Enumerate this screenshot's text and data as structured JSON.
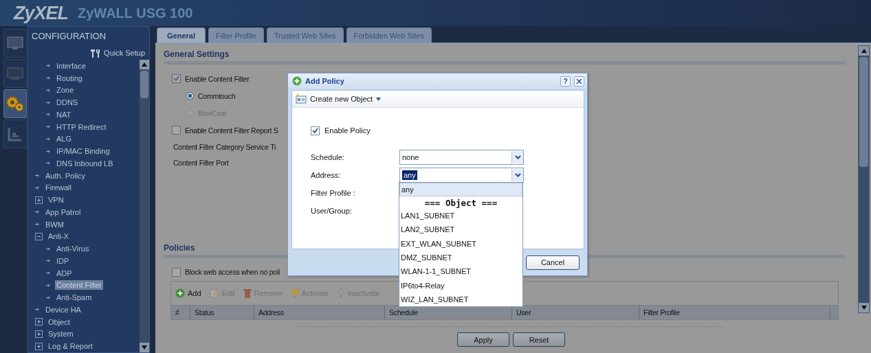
{
  "header": {
    "logo": "ZyXEL",
    "product": "ZyWALL USG 100"
  },
  "side_tabs": [
    {
      "kind": "monitor",
      "selected": false
    },
    {
      "kind": "screen",
      "selected": false
    },
    {
      "kind": "gears",
      "selected": true
    },
    {
      "kind": "chart",
      "selected": false
    }
  ],
  "nav": {
    "title": "CONFIGURATION",
    "quick_setup": "Quick Setup",
    "items": [
      {
        "kind": "continued",
        "children": [
          {
            "label": "Interface",
            "kind": "leaf",
            "selected": false
          },
          {
            "label": "Routing",
            "kind": "leaf",
            "selected": false
          },
          {
            "label": "Zone",
            "kind": "leaf",
            "selected": false
          },
          {
            "label": "DDNS",
            "kind": "leaf",
            "selected": false
          },
          {
            "label": "NAT",
            "kind": "leaf",
            "selected": false
          },
          {
            "label": "HTTP Redirect",
            "kind": "leaf",
            "selected": false
          },
          {
            "label": "ALG",
            "kind": "leaf",
            "selected": false
          },
          {
            "label": "IP/MAC Binding",
            "kind": "leaf",
            "selected": false
          },
          {
            "label": "DNS Inbound LB",
            "kind": "leaf",
            "selected": false
          }
        ]
      },
      {
        "label": "Auth. Policy",
        "kind": "leaf",
        "selected": false
      },
      {
        "label": "Firewall",
        "kind": "leaf",
        "selected": false
      },
      {
        "label": "VPN",
        "kind": "group",
        "expanded": false,
        "selected": false
      },
      {
        "label": "App Patrol",
        "kind": "leaf",
        "selected": false
      },
      {
        "label": "BWM",
        "kind": "leaf",
        "selected": false
      },
      {
        "label": "Anti-X",
        "kind": "group",
        "expanded": true,
        "selected": false,
        "children": [
          {
            "label": "Anti-Virus",
            "kind": "leaf",
            "selected": false
          },
          {
            "label": "IDP",
            "kind": "leaf",
            "selected": false
          },
          {
            "label": "ADP",
            "kind": "leaf",
            "selected": false
          },
          {
            "label": "Content Filter",
            "kind": "leaf",
            "selected": true
          },
          {
            "label": "Anti-Spam",
            "kind": "leaf",
            "selected": false
          }
        ]
      },
      {
        "label": "Device HA",
        "kind": "leaf",
        "selected": false
      },
      {
        "label": "Object",
        "kind": "group",
        "expanded": false,
        "selected": false
      },
      {
        "label": "System",
        "kind": "group",
        "expanded": false,
        "selected": false
      },
      {
        "label": "Log & Report",
        "kind": "group",
        "expanded": false,
        "selected": false
      }
    ]
  },
  "tabs": [
    {
      "label": "General",
      "selected": true
    },
    {
      "label": "Filter Profile",
      "selected": false
    },
    {
      "label": "Trusted Web Sites",
      "selected": false
    },
    {
      "label": "Forbidden Web Sites",
      "selected": false
    }
  ],
  "general": {
    "heading": "General Settings",
    "enable_filter": {
      "label": "Enable Content Filter",
      "checked": true
    },
    "providers": [
      {
        "label": "Commtouch",
        "selected": true,
        "disabled": false
      },
      {
        "label": "BlueCoat",
        "selected": false,
        "disabled": true
      }
    ],
    "report": {
      "label": "Enable Content Filter Report S",
      "checked": false
    },
    "labels": [
      "Content Filter Category Service Ti",
      "Content Filter Port"
    ]
  },
  "policies": {
    "heading": "Policies",
    "block": {
      "label": "Block web access when no poli",
      "checked": false
    },
    "toolbar": [
      {
        "label": "Add",
        "kind": "add",
        "disabled": false
      },
      {
        "label": "Edit",
        "kind": "edit",
        "disabled": true
      },
      {
        "label": "Remove",
        "kind": "remove",
        "disabled": true
      },
      {
        "label": "Activate",
        "kind": "activate",
        "disabled": true
      },
      {
        "label": "Inactivate",
        "kind": "inactivate",
        "disabled": true
      }
    ],
    "columns": [
      "#",
      "Status",
      "Address",
      "Schedule",
      "User",
      "Filter Profile"
    ]
  },
  "buttons": [
    "Apply",
    "Reset"
  ],
  "dialog": {
    "title": "Add Policy",
    "help": "?",
    "create_object": "Create new Object",
    "enable_policy": {
      "label": "Enable Policy",
      "checked": true
    },
    "fields": [
      {
        "label": "Schedule:",
        "value": "none"
      },
      {
        "label": "Address:",
        "value": "any",
        "options": [
          {
            "label": "any",
            "kind": "option",
            "selected": true
          },
          {
            "label": "=== Object ===",
            "kind": "header"
          },
          {
            "label": "LAN1_SUBNET",
            "kind": "option",
            "selected": false
          },
          {
            "label": "LAN2_SUBNET",
            "kind": "option",
            "selected": false
          },
          {
            "label": "EXT_WLAN_SUBNET",
            "kind": "option",
            "selected": false
          },
          {
            "label": "DMZ_SUBNET",
            "kind": "option",
            "selected": false
          },
          {
            "label": "WLAN-1-1_SUBNET",
            "kind": "option",
            "selected": false
          },
          {
            "label": "IP6to4-Relay",
            "kind": "option",
            "selected": false
          },
          {
            "label": "WIZ_LAN_SUBNET",
            "kind": "option",
            "selected": false
          }
        ]
      },
      {
        "label": "Filter Profile :"
      },
      {
        "label": "User/Group:"
      }
    ],
    "cancel": "Cancel"
  }
}
